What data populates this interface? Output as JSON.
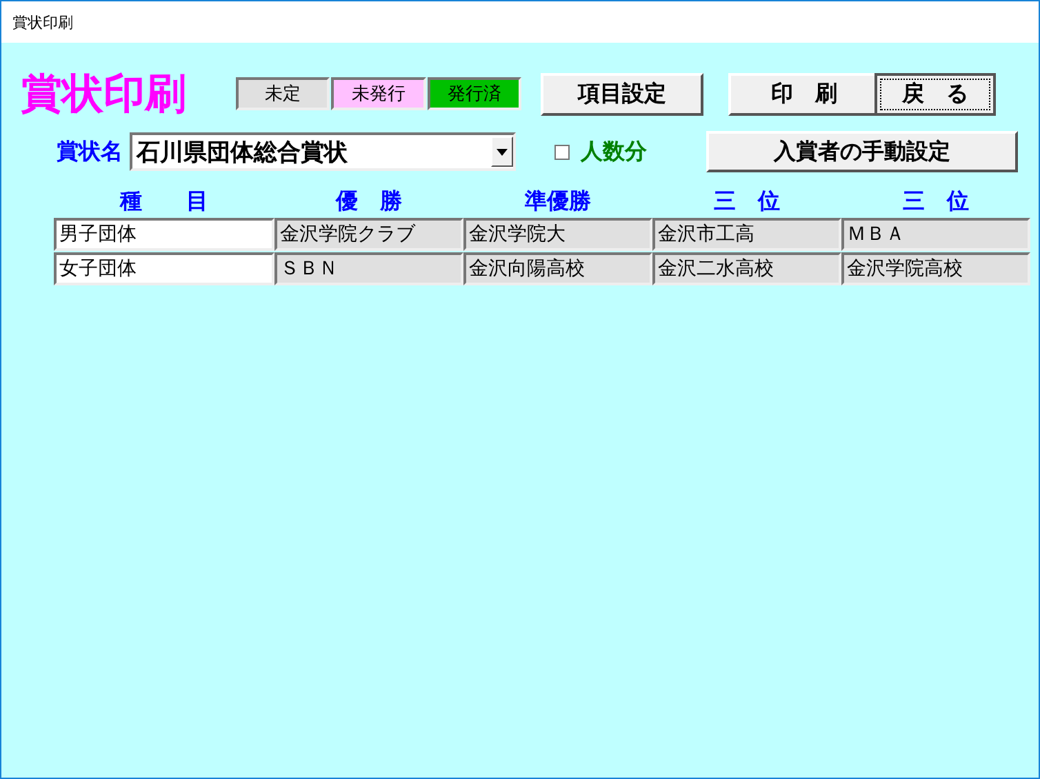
{
  "window": {
    "title": "賞状印刷"
  },
  "heading": "賞状印刷",
  "legend": [
    {
      "label": "未定",
      "color": "#e0e0e0"
    },
    {
      "label": "未発行",
      "color": "#ffc0ff"
    },
    {
      "label": "発行済",
      "color": "#00c000"
    }
  ],
  "buttons": [
    "項目設定",
    "印　刷",
    "戻　る"
  ],
  "award": {
    "label": "賞状名",
    "value": "石川県団体総合賞状"
  },
  "headcount": {
    "label": "人数分",
    "checked": false
  },
  "manual_button": "入賞者の手動設定",
  "table": {
    "columns": [
      "種　　目",
      "優　勝",
      "準優勝",
      "三　位",
      "三　位"
    ],
    "rows": [
      [
        "男子団体",
        "金沢学院クラブ",
        "金沢学院大",
        "金沢市工高",
        "ＭＢＡ"
      ],
      [
        "女子団体",
        "ＳＢＮ",
        "金沢向陽高校",
        "金沢二水高校",
        "金沢学院高校"
      ]
    ]
  }
}
